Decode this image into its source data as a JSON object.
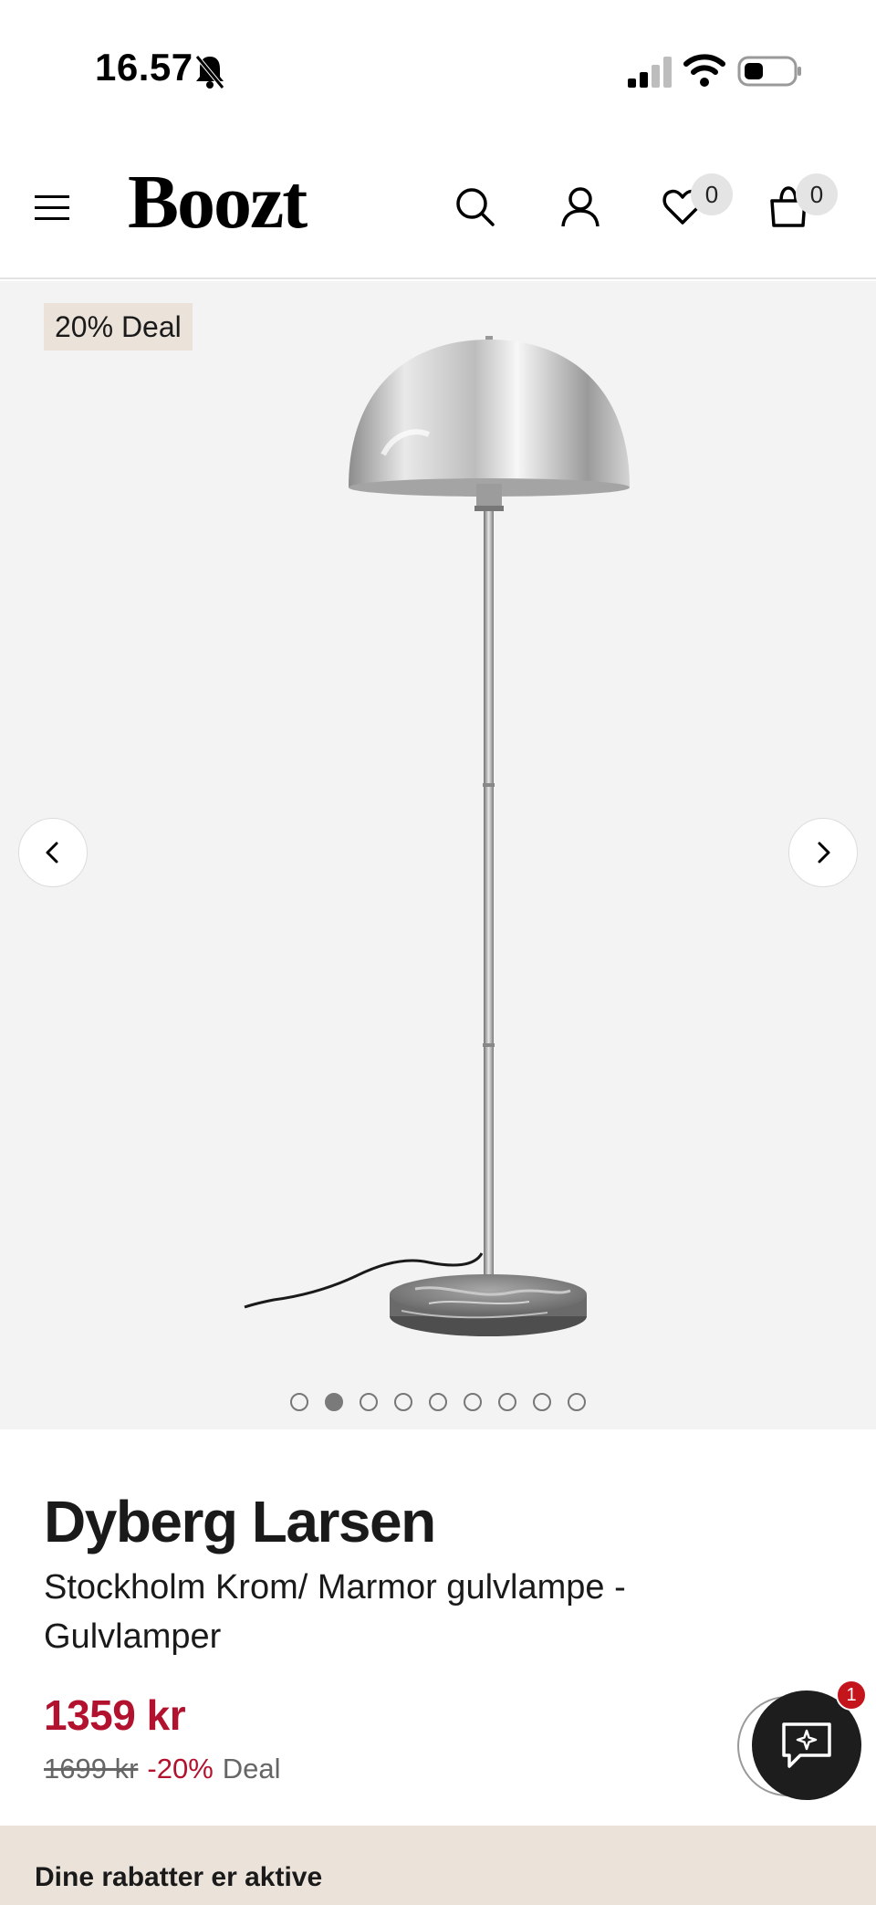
{
  "status_bar": {
    "time": "16.57",
    "icons": [
      "bell-slash-icon",
      "signal-icon",
      "wifi-icon",
      "battery-icon"
    ]
  },
  "header": {
    "logo": "Boozt",
    "icons": [
      "menu-icon",
      "search-icon",
      "user-icon",
      "heart-icon",
      "bag-icon"
    ],
    "wishlist_count": "0",
    "bag_count": "0"
  },
  "gallery": {
    "deal_tag": "20% Deal",
    "image_count": 9,
    "active_index": 1,
    "prev_icon": "chevron-left-icon",
    "next_icon": "chevron-right-icon"
  },
  "product": {
    "brand": "Dyberg Larsen",
    "name": "Stockholm Krom/ Marmor gulvlampe - Gulvlamper",
    "price": "1359 kr",
    "old_price": "1699 kr",
    "discount": "-20%",
    "deal_label": "Deal"
  },
  "chat": {
    "icon": "chat-sparkle-icon",
    "badge": "1"
  },
  "banner": {
    "text": "Dine rabatter er aktive"
  },
  "colors": {
    "price_red": "#b3122e",
    "deal_beige": "#ebe3da",
    "gallery_bg": "#f3f3f3",
    "chat_dark": "#1d1d1d",
    "badge_red": "#c4151c"
  }
}
